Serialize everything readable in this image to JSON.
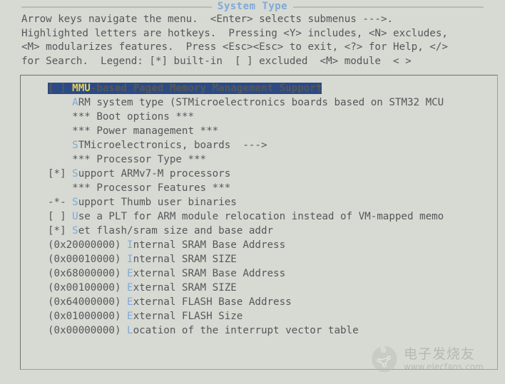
{
  "window": {
    "title": "System Type"
  },
  "help_header": {
    "lines": [
      "Arrow keys navigate the menu.  <Enter> selects submenus --->.",
      "Highlighted letters are hotkeys.  Pressing <Y> includes, <N> excludes,",
      "<M> modularizes features.  Press <Esc><Esc> to exit, <?> for Help, </>",
      "for Search.  Legend: [*] built-in  [ ] excluded  <M> module  < >"
    ]
  },
  "menu": {
    "rows": [
      {
        "prefix": "[ ] ",
        "hotkey": "MMU",
        "body": "-based Paged Memory Management Support",
        "selected": true,
        "name": "menu-item-mmu-based-paged-memory-management-support"
      },
      {
        "prefix": "    ",
        "hotkey": "A",
        "body": "RM system type (STMicroelectronics boards based on STM32 MCU",
        "selected": false,
        "name": "menu-item-arm-system-type"
      },
      {
        "prefix": "    ",
        "hotkey": "",
        "body": "*** Boot options ***",
        "selected": false,
        "name": "menu-separator-boot-options"
      },
      {
        "prefix": "    ",
        "hotkey": "",
        "body": "*** Power management ***",
        "selected": false,
        "name": "menu-separator-power-management"
      },
      {
        "prefix": "    ",
        "hotkey": "S",
        "body": "TMicroelectronics, boards  --->",
        "selected": false,
        "name": "menu-item-stmicroelectronics-boards"
      },
      {
        "prefix": "    ",
        "hotkey": "",
        "body": "*** Processor Type ***",
        "selected": false,
        "name": "menu-separator-processor-type"
      },
      {
        "prefix": "[*] ",
        "hotkey": "S",
        "body": "upport ARMv7-M processors",
        "selected": false,
        "name": "menu-item-support-armv7m-processors"
      },
      {
        "prefix": "    ",
        "hotkey": "",
        "body": "*** Processor Features ***",
        "selected": false,
        "name": "menu-separator-processor-features"
      },
      {
        "prefix": "-*- ",
        "hotkey": "S",
        "body": "upport Thumb user binaries",
        "selected": false,
        "name": "menu-item-support-thumb-user-binaries"
      },
      {
        "prefix": "[ ] ",
        "hotkey": "U",
        "body": "se a PLT for ARM module relocation instead of VM-mapped memo",
        "selected": false,
        "name": "menu-item-use-a-plt-for-arm-module-relocation"
      },
      {
        "prefix": "[*] ",
        "hotkey": "S",
        "body": "et flash/sram size and base addr",
        "selected": false,
        "name": "menu-item-set-flash-sram-size-and-base-addr"
      },
      {
        "prefix": "(0x20000000) ",
        "hotkey": "I",
        "body": "nternal SRAM Base Address",
        "selected": false,
        "name": "menu-item-internal-sram-base-address"
      },
      {
        "prefix": "(0x00010000) ",
        "hotkey": "I",
        "body": "nternal SRAM SIZE",
        "selected": false,
        "name": "menu-item-internal-sram-size"
      },
      {
        "prefix": "(0x68000000) ",
        "hotkey": "E",
        "body": "xternal SRAM Base Address",
        "selected": false,
        "name": "menu-item-external-sram-base-address"
      },
      {
        "prefix": "(0x00100000) ",
        "hotkey": "E",
        "body": "xternal SRAM SIZE",
        "selected": false,
        "name": "menu-item-external-sram-size"
      },
      {
        "prefix": "(0x64000000) ",
        "hotkey": "E",
        "body": "xternal FLASH Base Address",
        "selected": false,
        "name": "menu-item-external-flash-base-address"
      },
      {
        "prefix": "(0x01000000) ",
        "hotkey": "E",
        "body": "xternal FLASH Size",
        "selected": false,
        "name": "menu-item-external-flash-size"
      },
      {
        "prefix": "(0x00000000) ",
        "hotkey": "L",
        "body": "ocation of the interrupt vector table",
        "selected": false,
        "name": "menu-item-location-of-the-interrupt-vector-table"
      }
    ]
  },
  "watermark": {
    "cn_text": "电子发烧友",
    "url_text": "www.elecfans.com"
  },
  "colors": {
    "background": "#d7d9d3",
    "text": "#55585a",
    "hotkey": "#7fa9d6",
    "title": "#7fa9d6",
    "selection_bg": "#2b4a86",
    "selection_fg": "#ffffff",
    "selection_hotkey": "#e8d24a"
  }
}
